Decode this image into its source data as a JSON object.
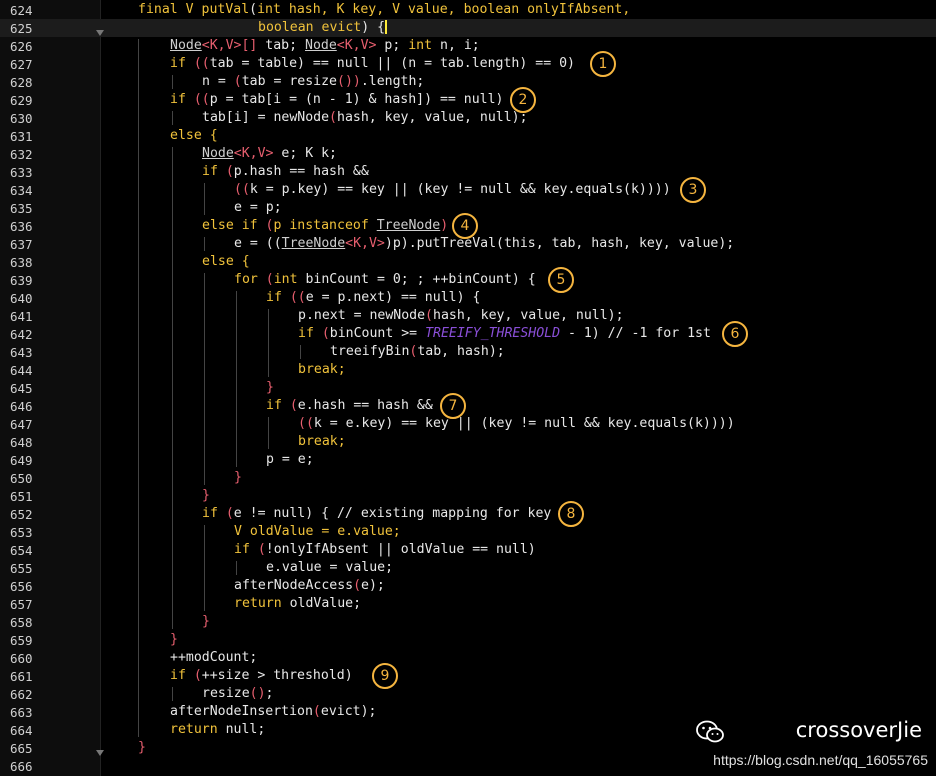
{
  "editor": {
    "current_line": 625,
    "lines": [
      {
        "n": "624",
        "tokens": [
          [
            "final V putVal",
            "#f0c23b"
          ],
          [
            "(",
            "#e8e8e8"
          ],
          [
            "int ",
            "#f0c23b"
          ],
          [
            "hash, ",
            "#f0c23b"
          ],
          [
            "K key, V value, ",
            "#f0c23b"
          ],
          [
            "boolean onlyIfAbsent,",
            "#f0c23b"
          ]
        ],
        "indent": 0
      },
      {
        "n": "625",
        "tokens": [
          [
            "boolean evict",
            "#f0c23b"
          ],
          [
            ") {",
            "#e8e8e8"
          ]
        ],
        "indent": 15
      },
      {
        "n": "626",
        "tokens": [
          [
            "Node",
            "#cfcfcf"
          ],
          [
            "<K,V>[] ",
            "#e85f6f"
          ],
          [
            "tab; ",
            "#e8e8e8"
          ],
          [
            "Node",
            "#cfcfcf"
          ],
          [
            "<K,V> ",
            "#e85f6f"
          ],
          [
            "p; ",
            "#e8e8e8"
          ],
          [
            "int ",
            "#f0c23b"
          ],
          [
            "n, i;",
            "#e8e8e8"
          ]
        ],
        "indent": 4
      },
      {
        "n": "627",
        "tokens": [
          [
            "if ",
            "#f0c23b"
          ],
          [
            "((",
            "#e85f6f"
          ],
          [
            "tab = table) == null || ",
            "#e8e8e8"
          ],
          [
            "(n = tab.length) == 0)",
            "#e8e8e8"
          ]
        ],
        "indent": 4
      },
      {
        "n": "628",
        "tokens": [
          [
            "n = ",
            "#e8e8e8"
          ],
          [
            "(",
            "#e85f6f"
          ],
          [
            "tab = resize",
            "#e8e8e8"
          ],
          [
            "())",
            "#e85f6f"
          ],
          [
            ".length;",
            "#e8e8e8"
          ]
        ],
        "indent": 8
      },
      {
        "n": "629",
        "tokens": [
          [
            "if ",
            "#f0c23b"
          ],
          [
            "((",
            "#e85f6f"
          ],
          [
            "p = tab[i = (n - 1) & hash]) == null)",
            "#e8e8e8"
          ]
        ],
        "indent": 4
      },
      {
        "n": "630",
        "tokens": [
          [
            "tab[i] = newNode",
            "#e8e8e8"
          ],
          [
            "(",
            "#e85f6f"
          ],
          [
            "hash, key, value, null);",
            "#e8e8e8"
          ]
        ],
        "indent": 8
      },
      {
        "n": "631",
        "tokens": [
          [
            "else {",
            "#f0c23b"
          ]
        ],
        "indent": 4
      },
      {
        "n": "632",
        "tokens": [
          [
            "Node",
            "#cfcfcf"
          ],
          [
            "<K,V> ",
            "#e85f6f"
          ],
          [
            "e; K k;",
            "#e8e8e8"
          ]
        ],
        "indent": 8
      },
      {
        "n": "633",
        "tokens": [
          [
            "if ",
            "#f0c23b"
          ],
          [
            "(",
            "#e85f6f"
          ],
          [
            "p.hash == hash &&",
            "#e8e8e8"
          ]
        ],
        "indent": 8
      },
      {
        "n": "634",
        "tokens": [
          [
            "((",
            "#e85f6f"
          ],
          [
            "k = p.key) == key || (key != null && key.equals(k))))",
            "#e8e8e8"
          ]
        ],
        "indent": 12
      },
      {
        "n": "635",
        "tokens": [
          [
            "e = p;",
            "#e8e8e8"
          ]
        ],
        "indent": 12
      },
      {
        "n": "636",
        "tokens": [
          [
            "else if ",
            "#f0c23b"
          ],
          [
            "(",
            "#e85f6f"
          ],
          [
            "p instanceof ",
            "#f0c23b"
          ],
          [
            "TreeNode",
            "#cfcfcf"
          ],
          [
            ")",
            "#e85f6f"
          ]
        ],
        "indent": 8
      },
      {
        "n": "637",
        "tokens": [
          [
            "e = ((",
            "#e8e8e8"
          ],
          [
            "TreeNode",
            "#cfcfcf"
          ],
          [
            "<K,V>",
            "#e85f6f"
          ],
          [
            ")p).putTreeVal(this, tab, hash, key, value);",
            "#e8e8e8"
          ]
        ],
        "indent": 12
      },
      {
        "n": "638",
        "tokens": [
          [
            "else {",
            "#f0c23b"
          ]
        ],
        "indent": 8
      },
      {
        "n": "639",
        "tokens": [
          [
            "for ",
            "#f0c23b"
          ],
          [
            "(",
            "#e85f6f"
          ],
          [
            "int ",
            "#f0c23b"
          ],
          [
            "binCount = 0; ; ++binCount) {",
            "#e8e8e8"
          ]
        ],
        "indent": 12
      },
      {
        "n": "640",
        "tokens": [
          [
            "if ",
            "#f0c23b"
          ],
          [
            "((",
            "#e85f6f"
          ],
          [
            "e = p.next) == null) {",
            "#e8e8e8"
          ]
        ],
        "indent": 16
      },
      {
        "n": "641",
        "tokens": [
          [
            "p.next = newNode",
            "#e8e8e8"
          ],
          [
            "(",
            "#e85f6f"
          ],
          [
            "hash, key, value, null);",
            "#e8e8e8"
          ]
        ],
        "indent": 20
      },
      {
        "n": "642",
        "tokens": [
          [
            "if ",
            "#f0c23b"
          ],
          [
            "(",
            "#e85f6f"
          ],
          [
            "binCount >= ",
            "#e8e8e8"
          ],
          [
            "TREEIFY_THRESHOLD",
            "#8a4fd8"
          ],
          [
            " - 1) // -1 for 1st",
            "#e8e8e8"
          ]
        ],
        "indent": 20
      },
      {
        "n": "643",
        "tokens": [
          [
            "treeifyBin",
            "#e8e8e8"
          ],
          [
            "(",
            "#e85f6f"
          ],
          [
            "tab, hash);",
            "#e8e8e8"
          ]
        ],
        "indent": 24
      },
      {
        "n": "644",
        "tokens": [
          [
            "break;",
            "#f0c23b"
          ]
        ],
        "indent": 20
      },
      {
        "n": "645",
        "tokens": [
          [
            "}",
            "#e85f6f"
          ]
        ],
        "indent": 16
      },
      {
        "n": "646",
        "tokens": [
          [
            "if ",
            "#f0c23b"
          ],
          [
            "(",
            "#e85f6f"
          ],
          [
            "e.hash == hash &&",
            "#e8e8e8"
          ]
        ],
        "indent": 16
      },
      {
        "n": "647",
        "tokens": [
          [
            "((",
            "#e85f6f"
          ],
          [
            "k = e.key) == key || (key != null && key.equals(k))))",
            "#e8e8e8"
          ]
        ],
        "indent": 20
      },
      {
        "n": "648",
        "tokens": [
          [
            "break;",
            "#f0c23b"
          ]
        ],
        "indent": 20
      },
      {
        "n": "649",
        "tokens": [
          [
            "p = e;",
            "#e8e8e8"
          ]
        ],
        "indent": 16
      },
      {
        "n": "650",
        "tokens": [
          [
            "}",
            "#e85f6f"
          ]
        ],
        "indent": 12
      },
      {
        "n": "651",
        "tokens": [
          [
            "}",
            "#e85f6f"
          ]
        ],
        "indent": 8
      },
      {
        "n": "652",
        "tokens": [
          [
            "if ",
            "#f0c23b"
          ],
          [
            "(",
            "#e85f6f"
          ],
          [
            "e != null) { // existing mapping for key",
            "#e8e8e8"
          ]
        ],
        "indent": 8
      },
      {
        "n": "653",
        "tokens": [
          [
            "V oldValue = e.value;",
            "#f0c23b"
          ]
        ],
        "indent": 12
      },
      {
        "n": "654",
        "tokens": [
          [
            "if ",
            "#f0c23b"
          ],
          [
            "(",
            "#e85f6f"
          ],
          [
            "!onlyIfAbsent || oldValue == null)",
            "#e8e8e8"
          ]
        ],
        "indent": 12
      },
      {
        "n": "655",
        "tokens": [
          [
            "e.value = value;",
            "#e8e8e8"
          ]
        ],
        "indent": 16
      },
      {
        "n": "656",
        "tokens": [
          [
            "afterNodeAccess",
            "#e8e8e8"
          ],
          [
            "(",
            "#e85f6f"
          ],
          [
            "e);",
            "#e8e8e8"
          ]
        ],
        "indent": 12
      },
      {
        "n": "657",
        "tokens": [
          [
            "return ",
            "#f0c23b"
          ],
          [
            "oldValue;",
            "#e8e8e8"
          ]
        ],
        "indent": 12
      },
      {
        "n": "658",
        "tokens": [
          [
            "}",
            "#e85f6f"
          ]
        ],
        "indent": 8
      },
      {
        "n": "659",
        "tokens": [
          [
            "}",
            "#e85f6f"
          ]
        ],
        "indent": 4
      },
      {
        "n": "660",
        "tokens": [
          [
            "++modCount;",
            "#e8e8e8"
          ]
        ],
        "indent": 4
      },
      {
        "n": "661",
        "tokens": [
          [
            "if ",
            "#f0c23b"
          ],
          [
            "(",
            "#e85f6f"
          ],
          [
            "++size > threshold)",
            "#e8e8e8"
          ]
        ],
        "indent": 4
      },
      {
        "n": "662",
        "tokens": [
          [
            "resize",
            "#e8e8e8"
          ],
          [
            "()",
            "#e85f6f"
          ],
          [
            ";",
            "#e8e8e8"
          ]
        ],
        "indent": 8
      },
      {
        "n": "663",
        "tokens": [
          [
            "afterNodeInsertion",
            "#e8e8e8"
          ],
          [
            "(",
            "#e85f6f"
          ],
          [
            "evict);",
            "#e8e8e8"
          ]
        ],
        "indent": 4
      },
      {
        "n": "664",
        "tokens": [
          [
            "return ",
            "#f0c23b"
          ],
          [
            "null;",
            "#e8e8e8"
          ]
        ],
        "indent": 4
      },
      {
        "n": "665",
        "tokens": [
          [
            "}",
            "#e85f6f"
          ]
        ],
        "indent": 0
      },
      {
        "n": "666",
        "tokens": [],
        "indent": 0
      }
    ]
  },
  "badges": [
    {
      "label": "1",
      "line": "627"
    },
    {
      "label": "2",
      "line": "629"
    },
    {
      "label": "3",
      "line": "634"
    },
    {
      "label": "4",
      "line": "636"
    },
    {
      "label": "5",
      "line": "639"
    },
    {
      "label": "6",
      "line": "642"
    },
    {
      "label": "7",
      "line": "646"
    },
    {
      "label": "8",
      "line": "652"
    },
    {
      "label": "9",
      "line": "661"
    }
  ],
  "watermark": {
    "brand": "crossoverJie",
    "url": "https://blog.csdn.net/qq_16055765",
    "icon": "wechat-icon"
  }
}
